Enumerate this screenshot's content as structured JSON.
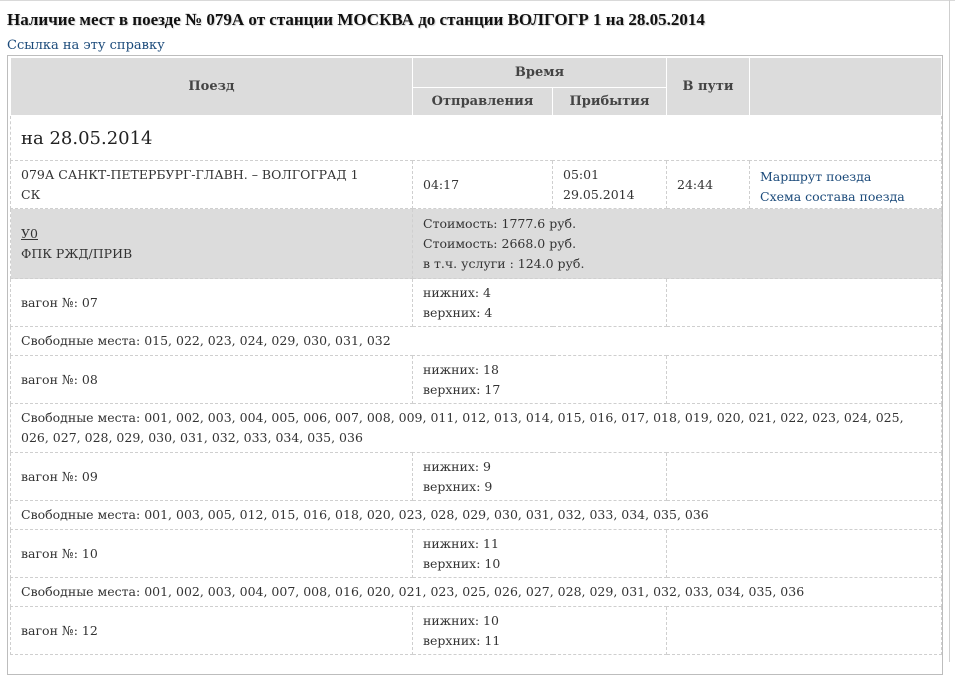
{
  "title": "Наличие мест в поезде № 079А от станции МОСКВА до станции ВОЛГОГР 1 на 28.05.2014",
  "link_text": "Ссылка на эту справку",
  "header": {
    "train": "Поезд",
    "time": "Время",
    "departure": "Отправления",
    "arrival": "Прибытия",
    "travel": "В пути"
  },
  "date_label": "на 28.05.2014",
  "train": {
    "name": "079А САНКТ-ПЕТЕРБУРГ-ГЛАВН. – ВОЛГОГРАД 1",
    "class": "СК",
    "departure": "04:17",
    "arrival_time": "05:01",
    "arrival_date": "29.05.2014",
    "duration": "24:44",
    "route_link": "Маршрут поезда",
    "scheme_link": "Схема состава поезда"
  },
  "car_class": {
    "code": "У0",
    "carrier": "ФПК РЖД/ПРИВ",
    "cost1": "Стоимость: 1777.6 руб.",
    "cost2": "Стоимость: 2668.0 руб.",
    "service": "в т.ч. услуги : 124.0 руб."
  },
  "wagons": [
    {
      "label": "вагон №: 07",
      "lower": "нижних: 4",
      "upper": "верхних: 4",
      "seats": "Свободные места: 015, 022, 023, 024, 029, 030, 031, 032"
    },
    {
      "label": "вагон №: 08",
      "lower": "нижних: 18",
      "upper": "верхних: 17",
      "seats": "Свободные места: 001, 002, 003, 004, 005, 006, 007, 008, 009, 011, 012, 013, 014, 015, 016, 017, 018, 019, 020, 021, 022, 023, 024, 025, 026, 027, 028, 029, 030, 031, 032, 033, 034, 035, 036"
    },
    {
      "label": "вагон №: 09",
      "lower": "нижних: 9",
      "upper": "верхних: 9",
      "seats": "Свободные места: 001, 003, 005, 012, 015, 016, 018, 020, 023, 028, 029, 030, 031, 032, 033, 034, 035, 036"
    },
    {
      "label": "вагон №: 10",
      "lower": "нижних: 11",
      "upper": "верхних: 10",
      "seats": "Свободные места: 001, 002, 003, 004, 007, 008, 016, 020, 021, 023, 025, 026, 027, 028, 029, 031, 032, 033, 034, 035, 036"
    },
    {
      "label": "вагон №: 12",
      "lower": "нижних: 10",
      "upper": "верхних: 11"
    }
  ]
}
